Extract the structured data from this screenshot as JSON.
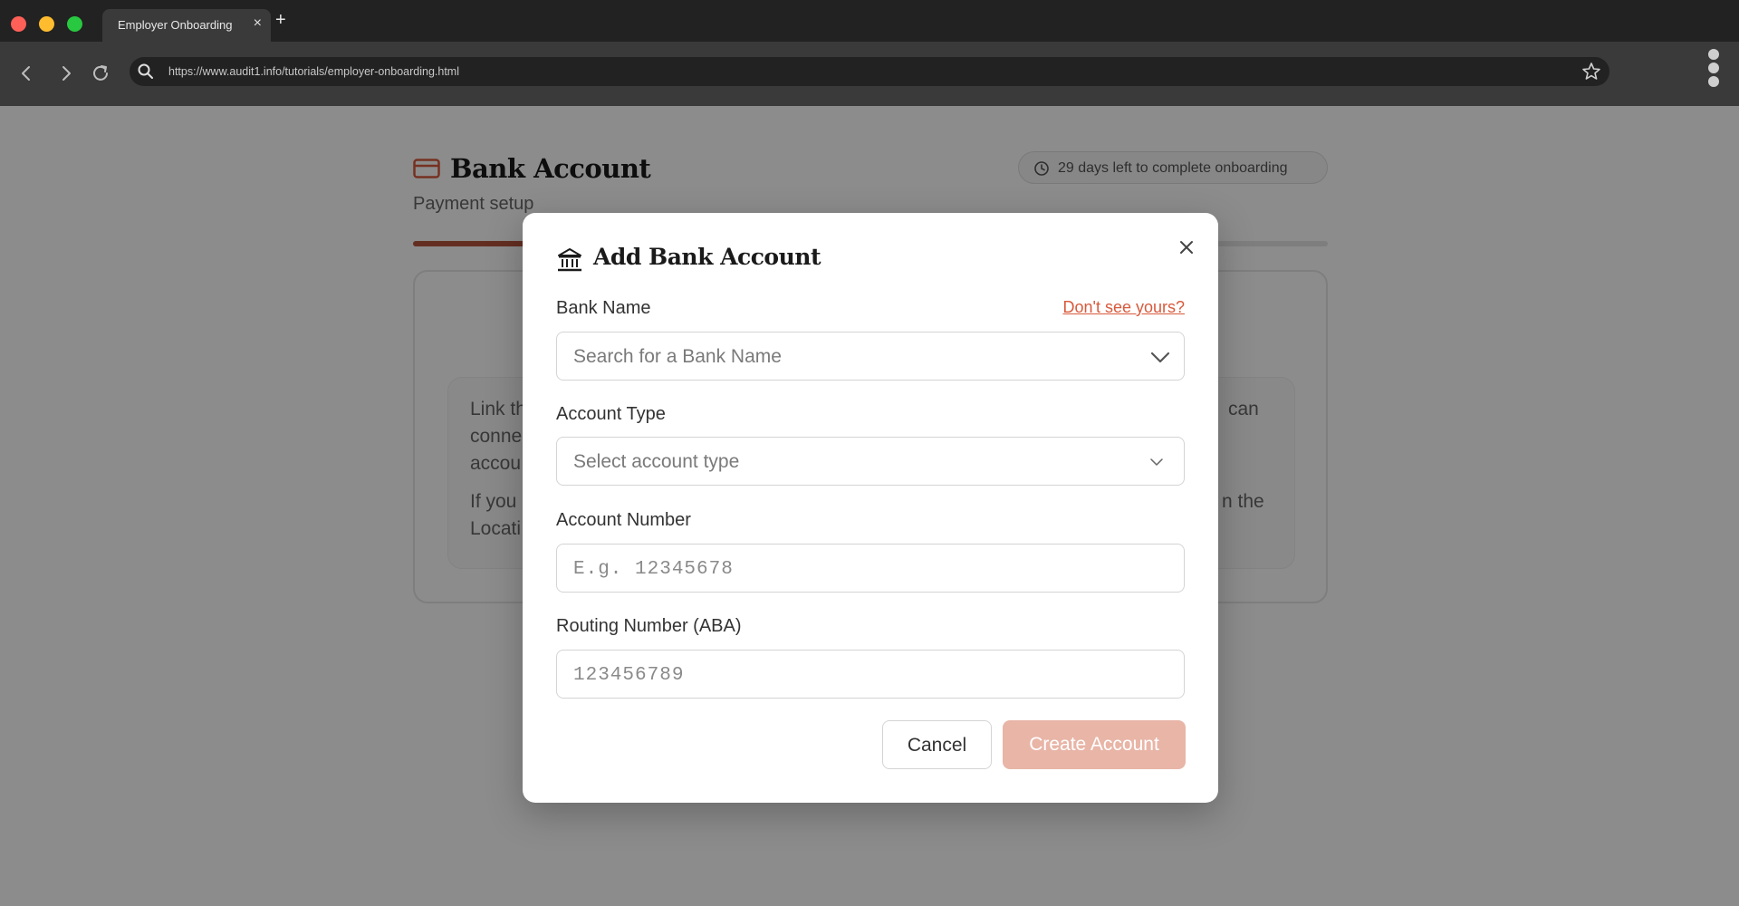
{
  "browser": {
    "tab_title": "Employer Onboarding",
    "tab_close": "×",
    "new_tab": "+",
    "url": "https://www.audit1.info/tutorials/employer-onboarding.html",
    "icons": [
      "back-icon",
      "forward-icon",
      "reload-icon",
      "search-icon",
      "star-icon",
      "menu-icon"
    ]
  },
  "page": {
    "title": "Bank Account",
    "subtitle": "Payment setup",
    "badge": "29 days left to complete onboarding",
    "progress_percent": 14,
    "info_visible_fragments": [
      "Link th",
      "conne",
      "accou",
      "If you",
      "Locati",
      "can",
      "n the"
    ]
  },
  "modal": {
    "title": "Add Bank Account",
    "bank_name_label": "Bank Name",
    "dont_see_link": "Don't see yours?",
    "bank_name_placeholder": "Search for a Bank Name",
    "account_type_label": "Account Type",
    "account_type_placeholder": "Select account type",
    "account_number_label": "Account Number",
    "account_number_placeholder": "E.g. 12345678",
    "routing_label": "Routing Number (ABA)",
    "routing_placeholder": "123456789",
    "cancel_label": "Cancel",
    "create_label": "Create Account"
  },
  "colors": {
    "accent": "#d85a3c",
    "progress": "#b4553d",
    "create_disabled": "#e8b5a7"
  }
}
